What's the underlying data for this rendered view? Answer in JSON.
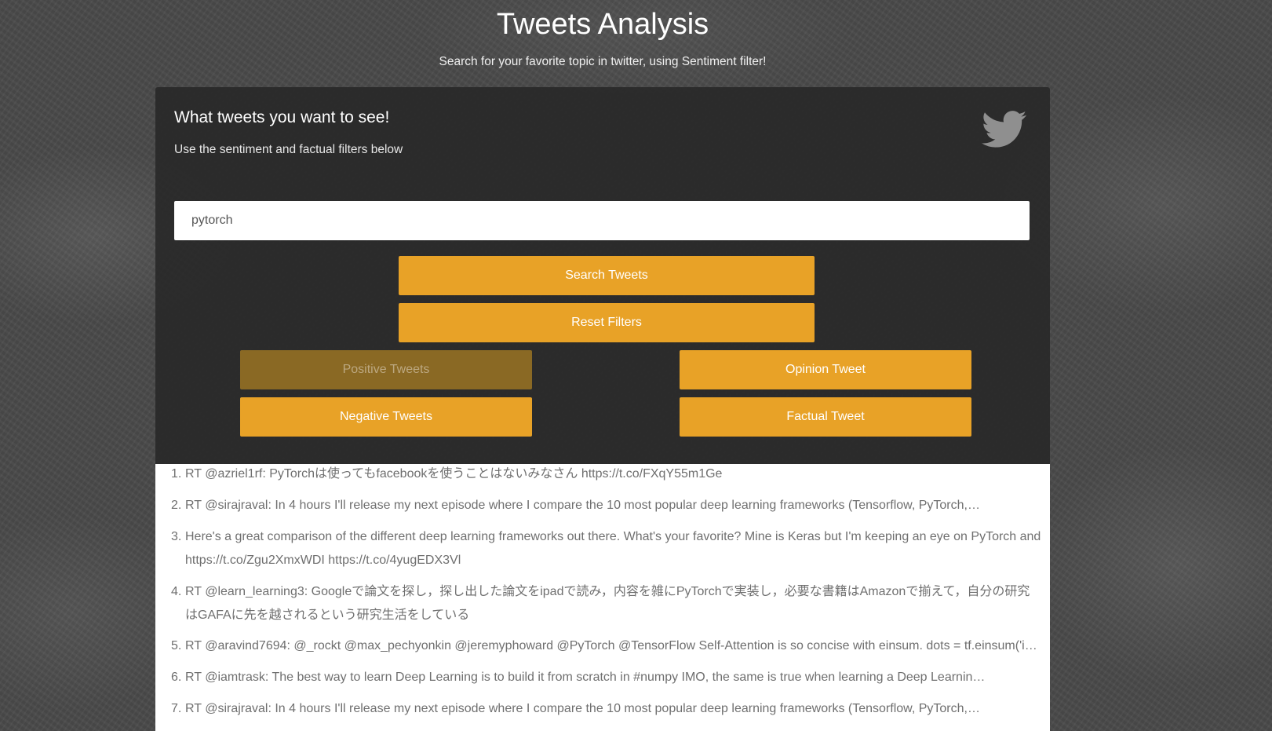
{
  "header": {
    "title": "Tweets Analysis",
    "subtitle": "Search for your favorite topic in twitter, using Sentiment filter!"
  },
  "panel": {
    "heading": "What tweets you want to see!",
    "subheading": "Use the sentiment and factual filters below",
    "icon": "twitter-bird-icon"
  },
  "search": {
    "value": "pytorch",
    "placeholder": ""
  },
  "buttons": {
    "search": "Search Tweets",
    "reset": "Reset Filters",
    "positive": "Positive Tweets",
    "negative": "Negative Tweets",
    "opinion": "Opinion Tweet",
    "factual": "Factual Tweet"
  },
  "colors": {
    "accent": "#e8a227",
    "accent_dimmed": "#8a6924",
    "panel_bg": "#262626",
    "results_bg": "#ffffff"
  },
  "tweets": [
    {
      "num": "1.",
      "text": "RT @azriel1rf: PyTorchは使ってもfacebookを使うことはないみなさん https://t.co/FXqY55m1Ge"
    },
    {
      "num": "2.",
      "text": "RT @sirajraval: In 4 hours I'll release my next episode where I compare the 10 most popular deep learning frameworks (Tensorflow, PyTorch,…"
    },
    {
      "num": "3.",
      "text": "Here's a great comparison of the different deep learning frameworks out there. What's your favorite? Mine is Keras but I'm keeping an eye on PyTorch and https://t.co/Zgu2XmxWDI https://t.co/4yugEDX3Vl"
    },
    {
      "num": "4.",
      "text": "RT @learn_learning3: Googleで論文を探し，探し出した論文をipadで読み，内容を雑にPyTorchで実装し，必要な書籍はAmazonで揃えて，自分の研究はGAFAに先を越されるという研究生活をしている"
    },
    {
      "num": "5.",
      "text": "RT @aravind7694: @_rockt @max_pechyonkin @jeremyphoward @PyTorch @TensorFlow Self-Attention is so concise with einsum. dots = tf.einsum('i…"
    },
    {
      "num": "6.",
      "text": "RT @iamtrask: The best way to learn Deep Learning is to build it from scratch in #numpy IMO, the same is true when learning a Deep Learnin…"
    },
    {
      "num": "7.",
      "text": "RT @sirajraval: In 4 hours I'll release my next episode where I compare the 10 most popular deep learning frameworks (Tensorflow, PyTorch,…"
    }
  ]
}
